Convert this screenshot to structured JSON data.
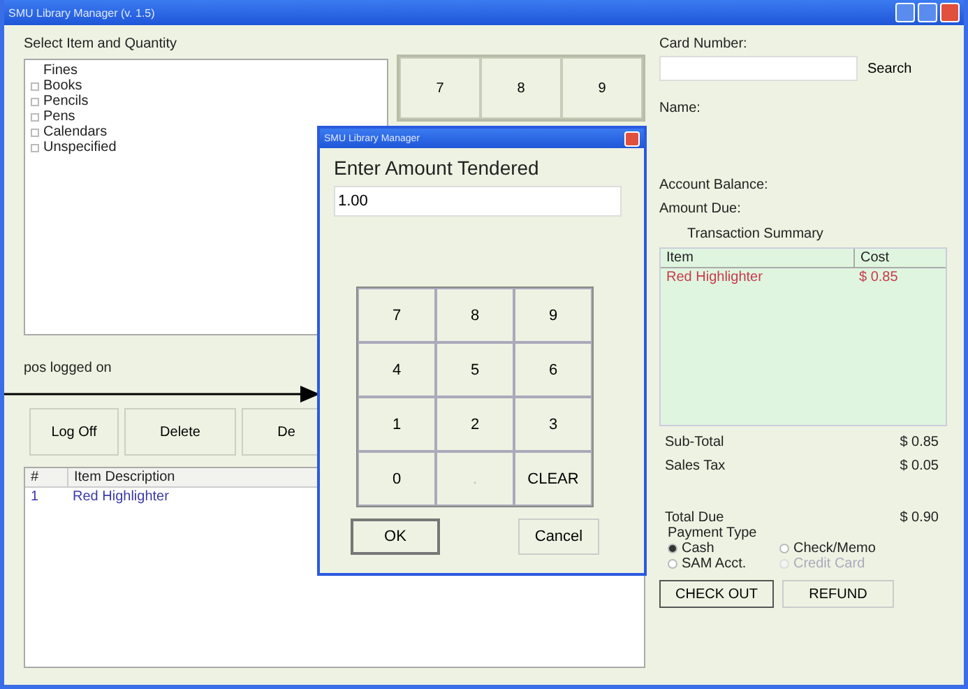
{
  "window": {
    "title": "SMU Library Manager (v. 1.5)"
  },
  "item_select": {
    "label": "Select Item and Quantity",
    "items": [
      {
        "label": "Fines",
        "expandable": false
      },
      {
        "label": "Books",
        "expandable": true
      },
      {
        "label": "Pencils",
        "expandable": true
      },
      {
        "label": "Pens",
        "expandable": true
      },
      {
        "label": "Calendars",
        "expandable": true
      },
      {
        "label": "Unspecified",
        "expandable": true
      }
    ]
  },
  "background_keypad": [
    "7",
    "8",
    "9"
  ],
  "status": "pos logged on",
  "buttons": [
    "Log Off",
    "Delete",
    "De"
  ],
  "items_table": {
    "columns": [
      "#",
      "Item Description"
    ],
    "rows": [
      [
        "1",
        "Red Highlighter"
      ]
    ]
  },
  "dialog": {
    "title": "SMU Library Manager",
    "prompt": "Enter Amount Tendered",
    "value": "1.00",
    "keys": [
      "7",
      "8",
      "9",
      "4",
      "5",
      "6",
      "1",
      "2",
      "3",
      "0",
      ".",
      "CLEAR"
    ],
    "buttons": [
      "OK",
      "Cancel"
    ]
  },
  "customer": {
    "card_label": "Card Number:",
    "search": "Search",
    "name_label": "Name:",
    "balance_label": "Account Balance:",
    "amount_due_label": "Amount Due:"
  },
  "summary": {
    "title": "Transaction Summary",
    "columns": [
      "Item",
      "Cost"
    ],
    "rows": [
      [
        "Red Highlighter",
        "$ 0.85"
      ]
    ]
  },
  "totals": [
    {
      "label": "Sub-Total",
      "value": "$ 0.85"
    },
    {
      "label": "Sales Tax",
      "value": "$ 0.05"
    },
    {
      "label": "Total Due",
      "value": "$ 0.90"
    }
  ],
  "payment": {
    "label": "Payment Type",
    "options": [
      {
        "label": "Cash",
        "selected": true,
        "disabled": false
      },
      {
        "label": "Check/Memo",
        "selected": false,
        "disabled": false
      },
      {
        "label": "SAM Acct.",
        "selected": false,
        "disabled": false
      },
      {
        "label": "Credit Card",
        "selected": false,
        "disabled": true
      }
    ]
  },
  "actions": [
    "CHECK OUT",
    "REFUND"
  ]
}
